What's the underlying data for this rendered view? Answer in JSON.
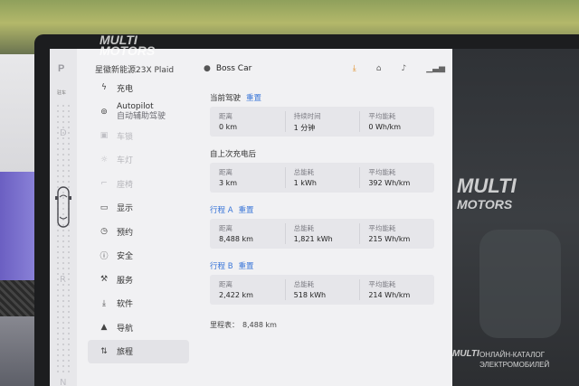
{
  "header": {
    "brand": "星徽新能源23X Plaid",
    "profile_name": "Boss Car"
  },
  "gear": {
    "letter": "P",
    "sub": "驻车"
  },
  "rail_letters": [
    "D",
    "R",
    "N"
  ],
  "menu": [
    {
      "icon": "bolt",
      "label": "充电",
      "active": false,
      "faded": false
    },
    {
      "icon": "steering-wheel",
      "label": "Autopilot",
      "sub": "自动辅助驾驶",
      "active": false,
      "faded": false
    },
    {
      "icon": "lock",
      "label": "车锁",
      "active": false,
      "faded": true
    },
    {
      "icon": "light",
      "label": "车灯",
      "active": false,
      "faded": true
    },
    {
      "icon": "seat",
      "label": "座椅",
      "active": false,
      "faded": true
    },
    {
      "icon": "display",
      "label": "显示",
      "active": false,
      "faded": false
    },
    {
      "icon": "clock",
      "label": "预约",
      "active": false,
      "faded": false
    },
    {
      "icon": "shield",
      "label": "安全",
      "active": false,
      "faded": false
    },
    {
      "icon": "wrench",
      "label": "服务",
      "active": false,
      "faded": false
    },
    {
      "icon": "download",
      "label": "软件",
      "active": false,
      "faded": false
    },
    {
      "icon": "navigation",
      "label": "导航",
      "active": false,
      "faded": false
    },
    {
      "icon": "trip",
      "label": "旅程",
      "active": true,
      "faded": false
    }
  ],
  "sections": [
    {
      "title": "当前驾驶",
      "reset": "重置",
      "blue": false,
      "cols": [
        {
          "label": "距离",
          "value": "0 km"
        },
        {
          "label": "持续时间",
          "value": "1 分钟"
        },
        {
          "label": "平均能耗",
          "value": "0 Wh/km"
        }
      ]
    },
    {
      "title": "自上次充电后",
      "reset": "",
      "blue": false,
      "cols": [
        {
          "label": "距离",
          "value": "3 km"
        },
        {
          "label": "总能耗",
          "value": "1 kWh"
        },
        {
          "label": "平均能耗",
          "value": "392 Wh/km"
        }
      ]
    },
    {
      "title": "行程 A",
      "reset": "重置",
      "blue": true,
      "cols": [
        {
          "label": "距离",
          "value": "8,488 km"
        },
        {
          "label": "总能耗",
          "value": "1,821 kWh"
        },
        {
          "label": "平均能耗",
          "value": "215 Wh/km"
        }
      ]
    },
    {
      "title": "行程 B",
      "reset": "重置",
      "blue": true,
      "cols": [
        {
          "label": "距离",
          "value": "2,422 km"
        },
        {
          "label": "总能耗",
          "value": "518 kWh"
        },
        {
          "label": "平均能耗",
          "value": "214 Wh/km"
        }
      ]
    }
  ],
  "odometer": {
    "label": "里程表：",
    "value": "8,488 km"
  },
  "watermarks": {
    "logo_line1": "MULTI",
    "logo_line2": "MOTORS",
    "catalog_line1": "ОНЛАЙН-КАТАЛОГ",
    "catalog_line2": "ЭЛЕКТРОМОБИЛЕЙ"
  },
  "colors": {
    "accent_blue": "#3a76d8",
    "download_orange": "#e08a1e"
  }
}
